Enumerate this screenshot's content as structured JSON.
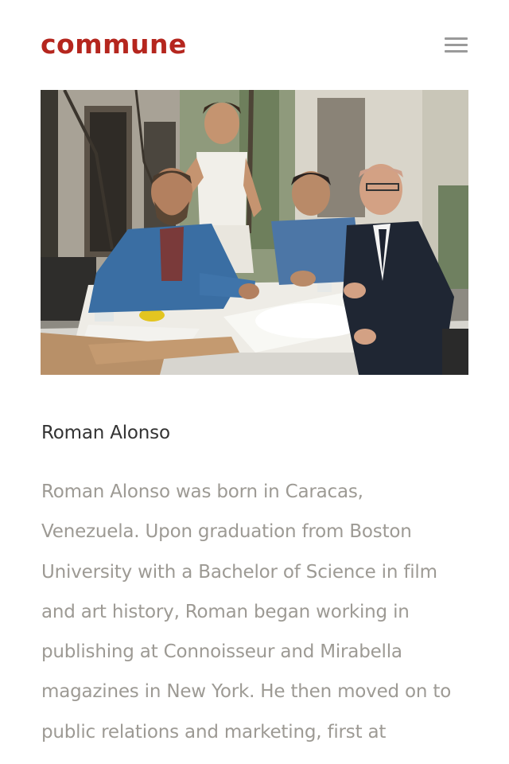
{
  "header": {
    "logo_text": "commune",
    "menu_icon": "hamburger-menu-icon"
  },
  "photo": {
    "icon": "team-photo"
  },
  "profile": {
    "name": "Roman Alonso",
    "bio": "Roman Alonso was born in Caracas,\nVenezuela. Upon graduation from Boston\nUniversity with a Bachelor of Science in film\nand art history, Roman began working in\npublishing at Connoisseur and Mirabella\nmagazines in New York. He then moved on to\npublic relations and marketing, first at"
  },
  "colors": {
    "brand": "#b5261e",
    "heading": "#333333",
    "body_text": "#9d9a94",
    "menu_icon": "#9a9a9a"
  }
}
